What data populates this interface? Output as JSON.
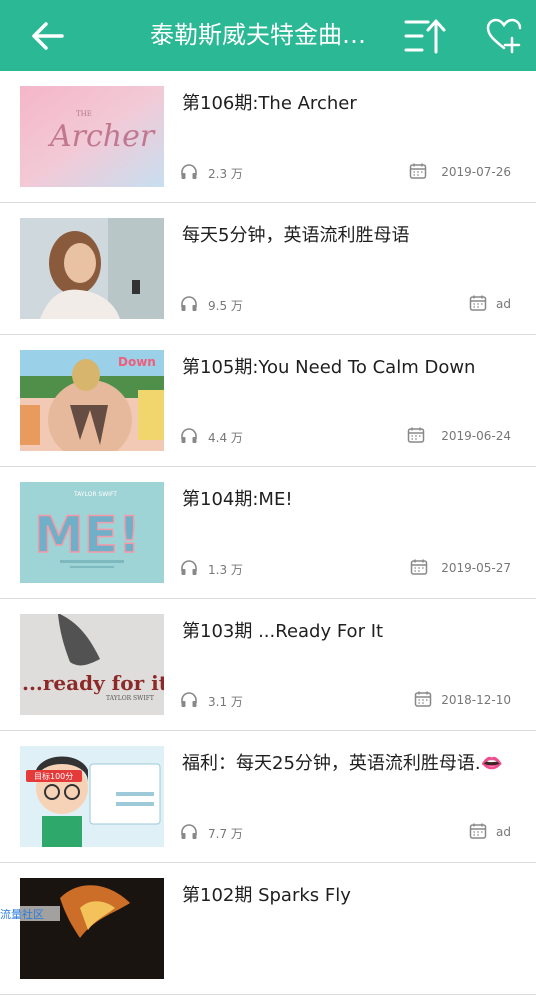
{
  "header": {
    "title": "泰勒斯威夫特金曲…"
  },
  "items": [
    {
      "title": "第106期:The Archer",
      "plays": "2.3 万",
      "date": "2019-07-26"
    },
    {
      "title": "每天5分钟，英语流利胜母语",
      "plays": "9.5 万",
      "date": "ad"
    },
    {
      "title": "第105期:You Need To Calm Down",
      "plays": "4.4 万",
      "date": "2019-06-24"
    },
    {
      "title": "第104期:ME!",
      "plays": "1.3 万",
      "date": "2019-05-27"
    },
    {
      "title": "第103期 ...Ready For It",
      "plays": "3.1 万",
      "date": "2018-12-10"
    },
    {
      "title": "福利：每天25分钟，英语流利胜母语.👄",
      "plays": "7.7 万",
      "date": "ad"
    },
    {
      "title": "第102期 Sparks Fly",
      "plays": "",
      "date": ""
    }
  ],
  "thumb_text": {
    "archer_the": "THE",
    "archer_word": "Archer",
    "calm_down": "Down",
    "me_artist": "TAYLOR SWIFT",
    "me_word": "ME!",
    "rfi_text": "...ready for it?",
    "rfi_artist": "TAYLOR SWIFT",
    "ad_badge": "目标100分"
  },
  "watermark": "流量社区"
}
